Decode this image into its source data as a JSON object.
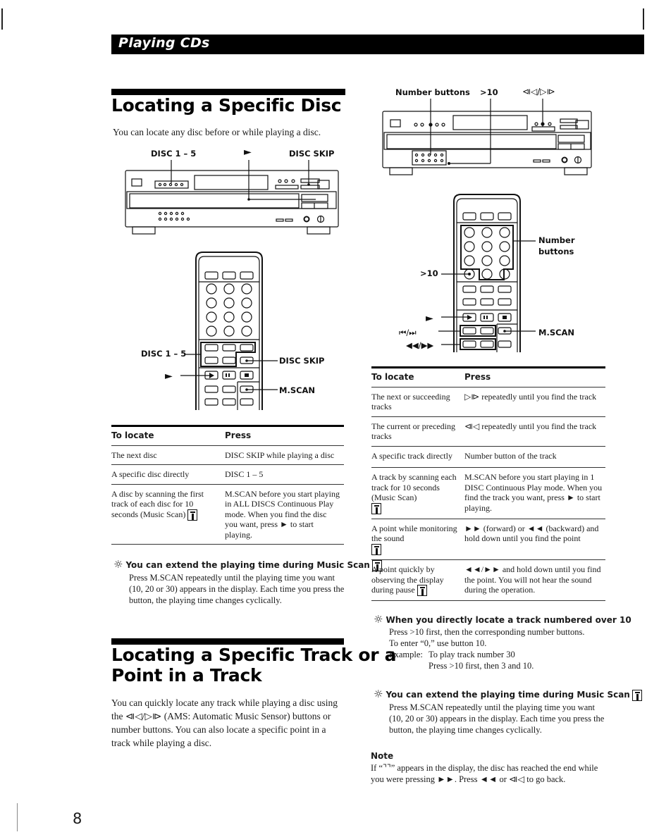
{
  "header": {
    "title": "Playing CDs"
  },
  "page_number": "8",
  "section1": {
    "title": "Locating a Specific Disc",
    "intro": "You can locate any disc before or while playing a disc.",
    "player_labels": {
      "disc15": "DISC 1 – 5",
      "play": "►",
      "disc_skip": "DISC SKIP"
    },
    "remote_labels": {
      "disc15": "DISC 1 – 5",
      "play": "►",
      "disc_skip": "DISC SKIP",
      "mscan": "M.SCAN"
    },
    "table": {
      "col1": "To locate",
      "col2": "Press",
      "rows": [
        {
          "locate": "The next disc",
          "press": "DISC SKIP while playing a disc",
          "icon": false
        },
        {
          "locate": "A specific disc directly",
          "press": "DISC 1 – 5",
          "icon": false
        },
        {
          "locate": "A disc by scanning the first track of each disc for 10 seconds (Music Scan)",
          "press": "M.SCAN before you start playing in ALL DISCS Continuous Play mode. When you find the disc you want, press ► to start playing.",
          "icon": true
        }
      ]
    },
    "tip": {
      "icon": "lightbulb-icon",
      "heading": "You can extend the playing time during Music Scan",
      "body": "Press M.SCAN repeatedly until the playing time you want (10, 20 or 30) appears in the display. Each time you press the button, the playing time changes cyclically."
    }
  },
  "section2": {
    "title_line1": "Locating a Specific Track or a",
    "title_line2": "Point in a Track",
    "intro": "You can quickly locate any track while playing a disc using the ⧏◁/▷⧐ (AMS: Automatic Music Sensor) buttons or number buttons. You can also locate a specific point in a track while playing a disc.",
    "player_labels": {
      "number_buttons": "Number buttons",
      "gt10": ">10",
      "ams": "⧏◁/▷⧐"
    },
    "remote_labels": {
      "number_buttons_1": "Number",
      "number_buttons_2": "buttons",
      "gt10": ">10",
      "play": "►",
      "skip": "⏮/⏭",
      "search": "◀◀/▶▶",
      "mscan": "M.SCAN"
    },
    "table": {
      "col1": "To locate",
      "col2": "Press",
      "rows": [
        {
          "locate": "The next or succeeding tracks",
          "press": "▷⧐ repeatedly until you find the track",
          "icon": false
        },
        {
          "locate": "The current or preceding tracks",
          "press": "⧏◁ repeatedly until you find the track",
          "icon": false
        },
        {
          "locate": "A specific track directly",
          "press": "Number button of the track",
          "icon": false
        },
        {
          "locate": "A track by scanning each track for 10 seconds (Music Scan)",
          "press": "M.SCAN before you start playing in 1 DISC Continuous Play mode. When you find the track you want, press ► to start playing.",
          "icon": true
        },
        {
          "locate": "A point while monitoring the sound",
          "press": "►► (forward) or ◄◄ (backward) and hold down until you find the point",
          "icon": true
        },
        {
          "locate": "A point quickly by observing the display during pause",
          "press": "◄◄/►► and hold down until you find the point. You will not hear the sound during the operation.",
          "icon": true
        }
      ]
    },
    "tip1": {
      "icon": "lightbulb-icon",
      "heading": "When you directly locate a track numbered over 10",
      "line1": "Press >10 first, then the corresponding number buttons.",
      "line2": "To enter “0,” use button 10.",
      "example_label": "Example:",
      "example_line1": "To play track number 30",
      "example_line2": "Press >10 first, then 3 and 10."
    },
    "tip2": {
      "icon": "lightbulb-icon",
      "heading": "You can extend the playing time during Music Scan",
      "body": "Press M.SCAN repeatedly until the playing time you want (10, 20 or 30) appears in the display. Each time you press the button, the playing time changes cyclically."
    },
    "note": {
      "heading": "Note",
      "body": "If “⌝⌝” appears in the display, the disc has reached the end while you were pressing ►►. Press ◄◄ or ⧏◁ to go back."
    }
  }
}
